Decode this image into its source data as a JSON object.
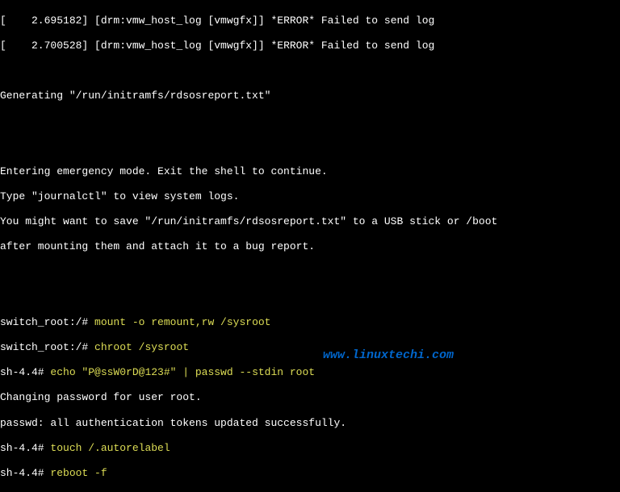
{
  "lines": {
    "l1a": "[    2.695182] [drm:vmw_host_log [vmwgfx]] ",
    "l1b": "*ERROR*",
    "l1c": " Failed to send log",
    "l2a": "[    2.700528] [drm:vmw_host_log [vmwgfx]] ",
    "l2b": "*ERROR*",
    "l2c": " Failed to send log",
    "l3": "Generating \"/run/initramfs/rdsosreport.txt\"",
    "l4": "Entering emergency mode. Exit the shell to continue.",
    "l5": "Type \"journalctl\" to view system logs.",
    "l6": "You might want to save \"/run/initramfs/rdsosreport.txt\" to a USB stick or /boot",
    "l7": "after mounting them and attach it to a bug report.",
    "p1": "switch_root:/# ",
    "c1": "mount -o remount,rw /sysroot",
    "p2": "switch_root:/# ",
    "c2": "chroot /sysroot",
    "p3": "sh-4.4# ",
    "c3": "echo \"P@ssW0rD@123#\" | passwd --stdin root",
    "l8": "Changing password for user root.",
    "l9": "passwd: all authentication tokens updated successfully.",
    "p4": "sh-4.4# ",
    "c4": "touch /.autorelabel",
    "p5": "sh-4.4# ",
    "c5": "reboot -f"
  },
  "watermark": "www.linuxtechi.com"
}
